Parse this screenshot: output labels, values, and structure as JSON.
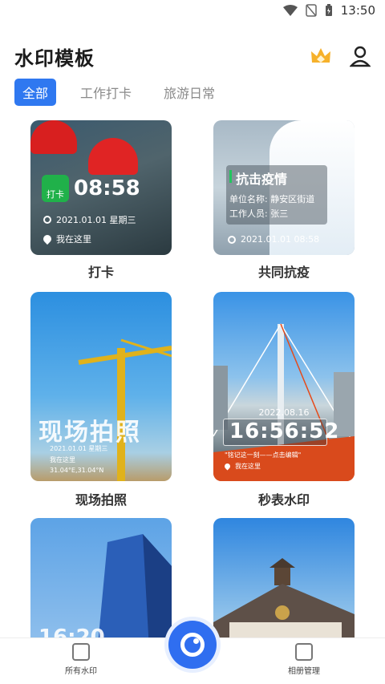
{
  "status_bar": {
    "time": "13:50"
  },
  "header": {
    "title": "水印模板",
    "vip_icon": "crown-icon",
    "user_icon": "user-icon"
  },
  "tabs": [
    {
      "label": "全部",
      "active": true
    },
    {
      "label": "工作打卡",
      "active": false
    },
    {
      "label": "旅游日常",
      "active": false
    }
  ],
  "cards": [
    {
      "caption": "打卡",
      "badge": "打卡",
      "time": "08:58",
      "date": "2021.01.01 星期三",
      "location": "我在这里"
    },
    {
      "caption": "共同抗疫",
      "title": "抗击疫情",
      "unit": "单位名称: 静安区街道",
      "staff": "工作人员: 张三",
      "datetime": "2021.01.01 08:58"
    },
    {
      "caption": "现场拍照",
      "overlay": "现场拍照",
      "date": "2021.01.01 星期三",
      "location": "我在这里",
      "coords": "31.04°E,31.04°N"
    },
    {
      "caption": "秒表水印",
      "date": "2022.08.16",
      "time": "16:56:52",
      "note": "\"铭记这一刻——点击编辑\"",
      "location": "我在这里"
    },
    {
      "caption": "",
      "time": "16:20"
    },
    {
      "caption": ""
    }
  ],
  "bottom_nav": {
    "left": "所有水印",
    "right": "相册管理"
  },
  "colors": {
    "accent": "#2f78f0",
    "tab_inactive": "#8a8a8a"
  }
}
